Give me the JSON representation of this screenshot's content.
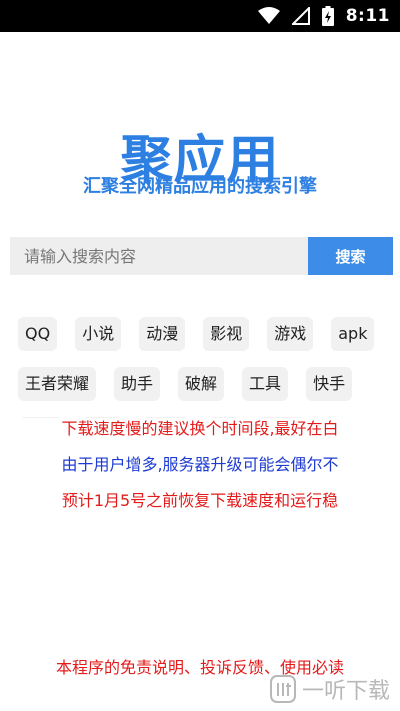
{
  "status_bar": {
    "time": "8:11",
    "icons": [
      "wifi-icon",
      "signal-icon",
      "battery-charging-icon"
    ]
  },
  "app": {
    "logo_text": "聚应用",
    "slogan": "汇聚全网精品应用的搜索引擎"
  },
  "search": {
    "placeholder": "请输入搜索内容",
    "button_label": "搜索"
  },
  "tags": {
    "row1": [
      "QQ",
      "小说",
      "动漫",
      "影视",
      "游戏",
      "apk"
    ],
    "row2": [
      "王者荣耀",
      "助手",
      "破解",
      "工具",
      "快手"
    ]
  },
  "notice": {
    "line1": "下载速度慢的建议换个时间段,最好在白",
    "line2": "由于用户增多,服务器升级可能会偶尔不",
    "line3": "预计1月5号之前恢复下载速度和运行稳"
  },
  "footer": {
    "link_text": "本程序的免责说明、投诉反馈、使用必读"
  },
  "watermark": {
    "text": "一听下载"
  },
  "colors": {
    "brand_blue": "#2d7fe2",
    "button_blue": "#3d8ce8",
    "notice_red": "#e41b1b",
    "notice_blue": "#1e3bd1"
  }
}
